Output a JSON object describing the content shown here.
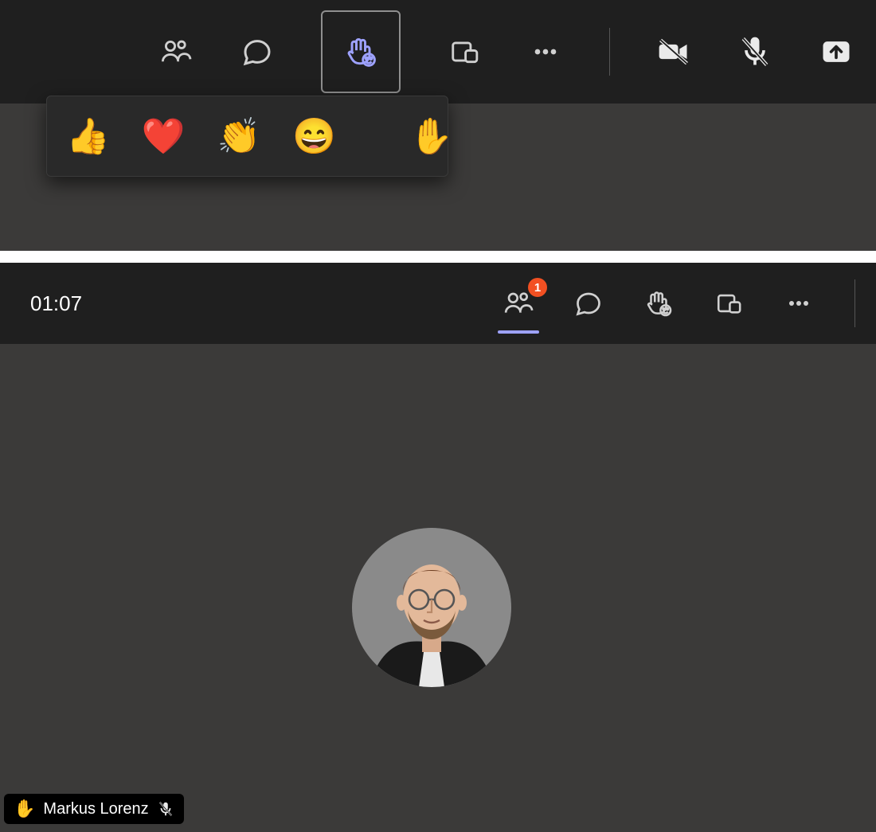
{
  "toolbar_top": {
    "icons": {
      "people": "people-icon",
      "chat": "chat-icon",
      "react": "react-hand-icon",
      "rooms": "rooms-icon",
      "more": "more-icon",
      "camera_off": "camera-off-icon",
      "mic_off": "mic-off-icon",
      "share": "share-screen-icon"
    }
  },
  "reactions": {
    "items": [
      "👍",
      "❤️",
      "👏",
      "😄"
    ],
    "raise_hand": "✋"
  },
  "call": {
    "duration": "01:07",
    "people_badge": "1"
  },
  "participant": {
    "raised_emoji": "✋",
    "name": "Markus Lorenz"
  }
}
